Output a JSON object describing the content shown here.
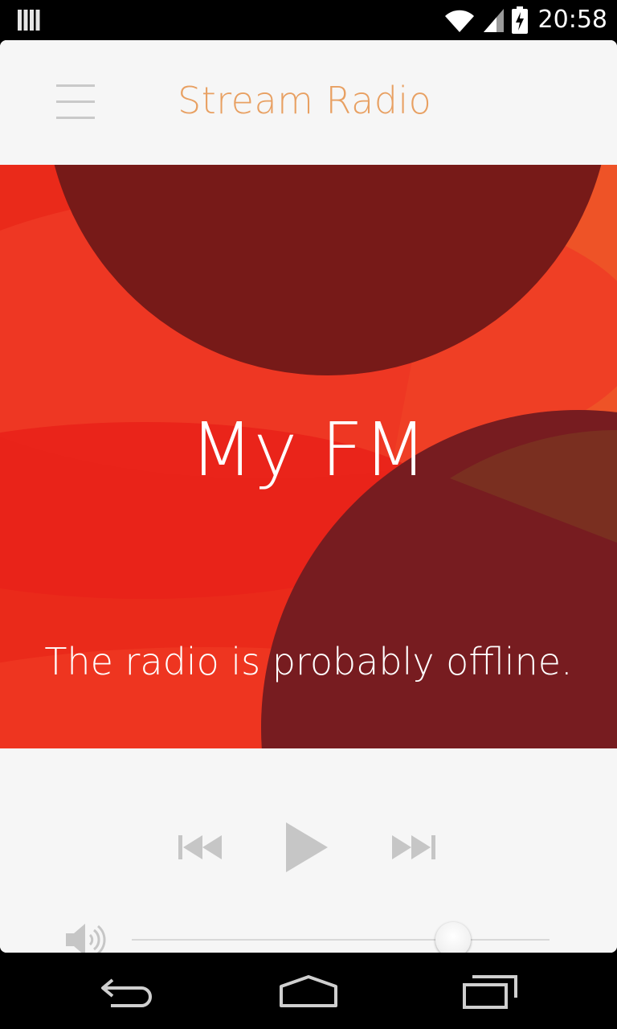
{
  "status_bar": {
    "time": "20:58",
    "icons": [
      "notification-bars-icon",
      "wifi-icon",
      "cell-signal-icon",
      "battery-charging-icon"
    ]
  },
  "app_bar": {
    "title": "Stream Radio",
    "menu_icon": "hamburger-menu-icon"
  },
  "station": {
    "name": "My FM",
    "status": "The radio is probably offline."
  },
  "controls": {
    "previous_icon": "skip-previous-icon",
    "play_icon": "play-icon",
    "next_icon": "skip-next-icon"
  },
  "volume": {
    "icon": "speaker-volume-icon",
    "level": 0.77
  },
  "nav_bar": {
    "icons": [
      "back-icon",
      "home-icon",
      "recent-apps-icon"
    ]
  },
  "colors": {
    "accent": "#e8a062",
    "background": "#f6f6f6",
    "artwork_base": "#ea2a1a",
    "controls": "#c6c6c6"
  }
}
